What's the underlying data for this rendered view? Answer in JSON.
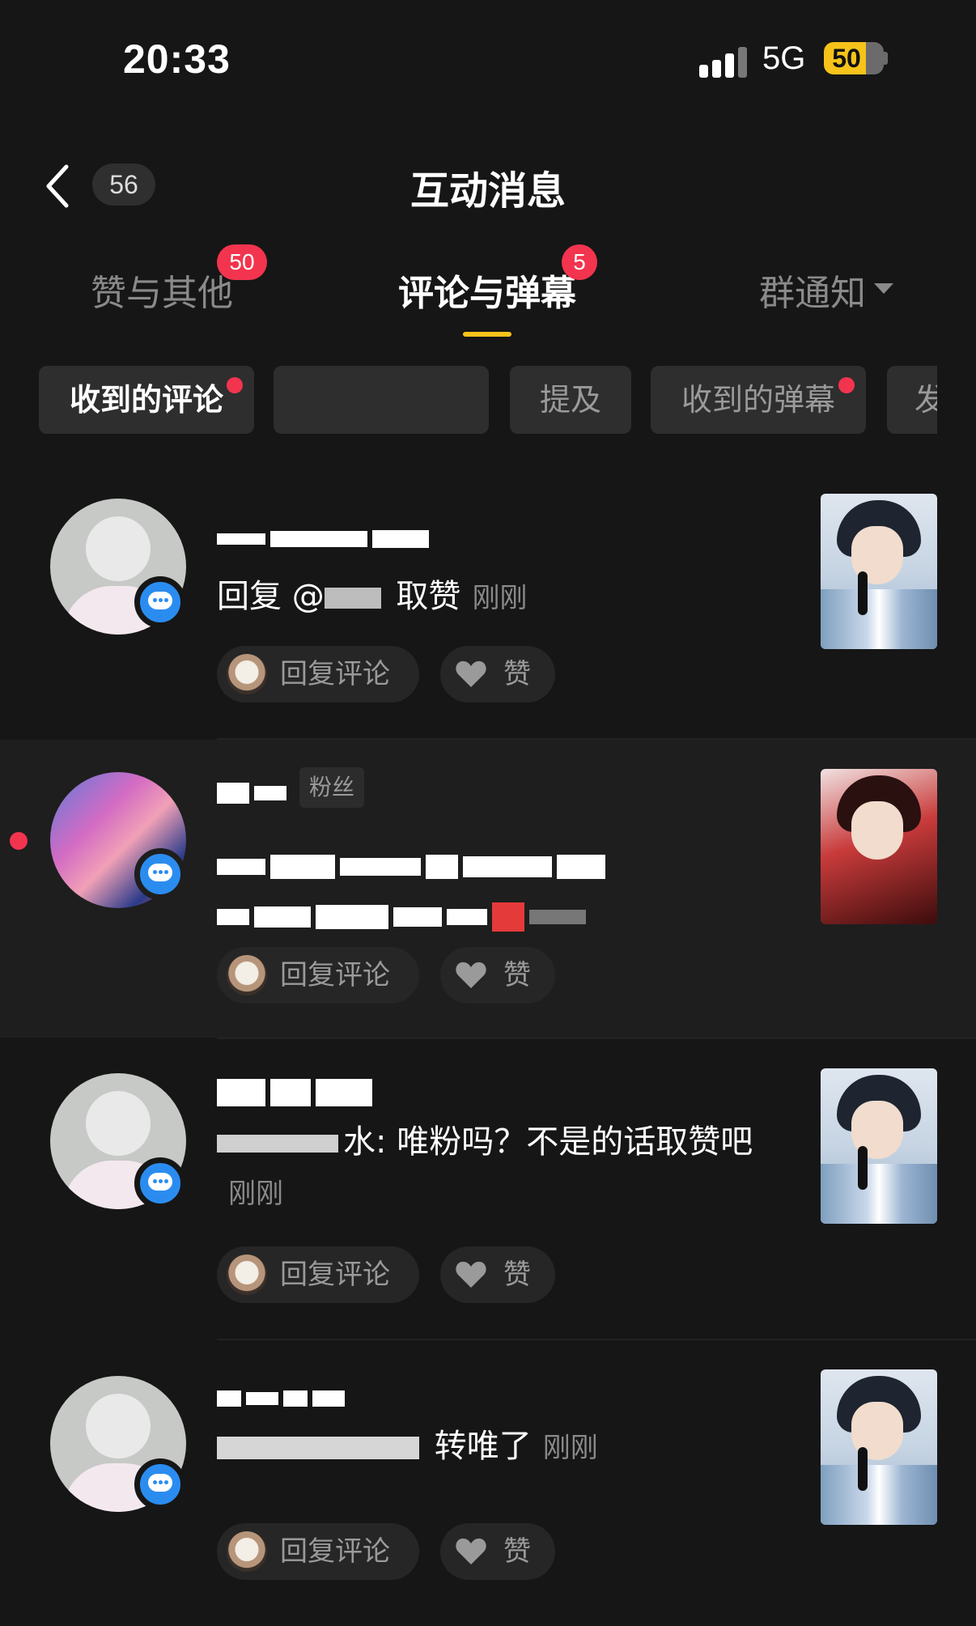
{
  "status_bar": {
    "time": "20:33",
    "network": "5G",
    "battery": "50"
  },
  "header": {
    "back_count": "56",
    "title": "互动消息"
  },
  "tabs": [
    {
      "label": "赞与其他",
      "badge": "50"
    },
    {
      "label": "评论与弹幕",
      "badge": "5"
    },
    {
      "label": "群通知",
      "badge": ""
    }
  ],
  "chips": [
    {
      "label": "收到的评论"
    },
    {
      "label": ""
    },
    {
      "label": "提及"
    },
    {
      "label": "收到的弹幕"
    },
    {
      "label": "发"
    }
  ],
  "actions": {
    "reply_label": "回复评论",
    "like_label": "赞"
  },
  "messages": [
    {
      "content_a": "回复 @",
      "content_b": " 取赞",
      "time": "刚刚"
    },
    {
      "tag": "粉丝"
    },
    {
      "content_a": "水: 唯粉吗？不是的话取赞吧",
      "time": "刚刚"
    },
    {
      "content_a": " 转唯了",
      "time": "刚刚"
    }
  ]
}
